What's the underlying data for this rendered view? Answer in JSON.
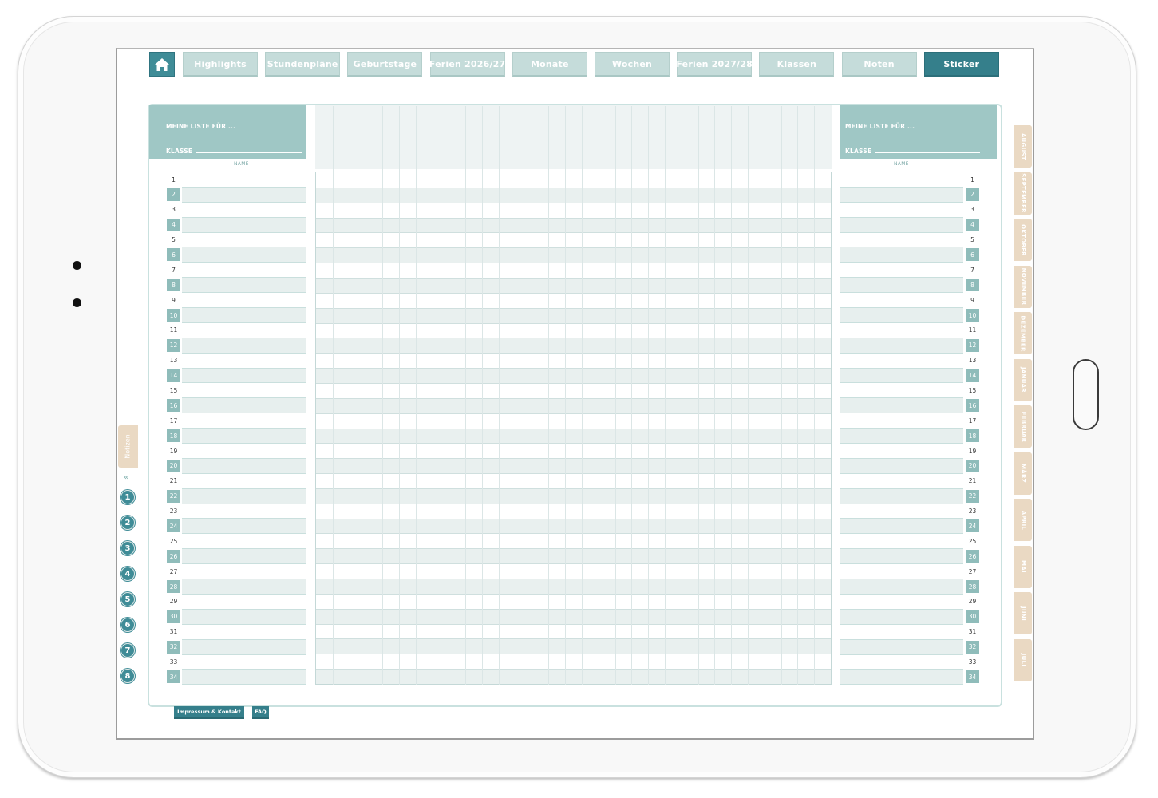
{
  "nav": {
    "tabs": [
      "Highlights",
      "Stundenpläne",
      "Geburtstage",
      "Ferien 2026/27",
      "Monate",
      "Wochen",
      "Ferien 2027/28",
      "Klassen",
      "Noten",
      "Sticker"
    ],
    "active": "Sticker"
  },
  "left_panel": {
    "title": "MEINE LISTE FÜR ...",
    "klasse": "KLASSE",
    "name_header": "NAME"
  },
  "right_panel": {
    "title": "MEINE LISTE FÜR ...",
    "klasse": "KLASSE",
    "name_header": "NAME"
  },
  "row_numbers": [
    "1",
    "2",
    "3",
    "4",
    "5",
    "6",
    "7",
    "8",
    "9",
    "10",
    "11",
    "12",
    "13",
    "14",
    "15",
    "16",
    "17",
    "18",
    "19",
    "20",
    "21",
    "22",
    "23",
    "24",
    "25",
    "26",
    "27",
    "28",
    "29",
    "30",
    "31",
    "32",
    "33",
    "34"
  ],
  "grid": {
    "columns": 31,
    "rows": 34
  },
  "months": [
    "AUGUST",
    "SEPTEMBER",
    "OKTOBER",
    "NOVEMBER",
    "DEZEMBER",
    "JANUAR",
    "FEBRUAR",
    "MÄRZ",
    "APRIL",
    "MAI",
    "JUNI",
    "JULI"
  ],
  "side": {
    "notes_label": "Notizen",
    "chevron": "«",
    "page_numbers": [
      "1",
      "2",
      "3",
      "4",
      "5",
      "6",
      "7",
      "8"
    ]
  },
  "footer": {
    "impressum": "Impressum & Kontakt",
    "faq": "FAQ"
  },
  "colors": {
    "teal_dark": "#357f8b",
    "teal_light": "#c5dcda",
    "teal_header": "#9fc7c5",
    "beige_tab": "#ead9c3"
  },
  "icons": {
    "home": "home-icon",
    "chevron": "double-chevron-down-icon"
  }
}
